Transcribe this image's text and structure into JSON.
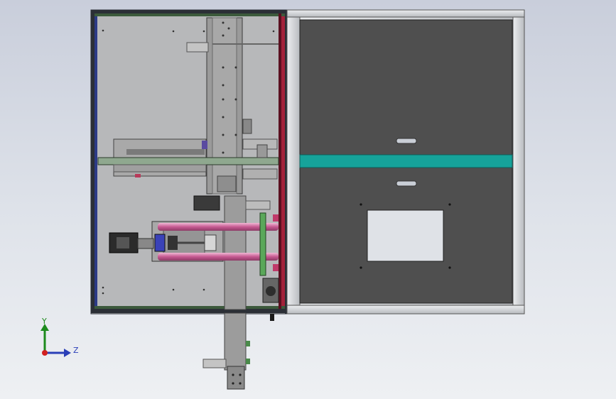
{
  "viewport": {
    "background_top": "#c9cedb",
    "background_bottom": "#eef0f3"
  },
  "colors": {
    "frame_dark": "#2b2f36",
    "frame_green": "#3c5a3c",
    "rail_blue": "#2c3a86",
    "rail_red": "#8a1a2a",
    "panel_dark": "#4f4f4f",
    "teal_strip": "#16a39a",
    "pink_rod": "#d27aa8",
    "plate_gray": "#8e8e8e",
    "aluminum": "#cfd1d4"
  },
  "triad": {
    "y_label": "Y",
    "z_label": "Z",
    "icons": [
      "y-axis-arrow-icon",
      "z-axis-arrow-icon",
      "origin-icon"
    ]
  }
}
